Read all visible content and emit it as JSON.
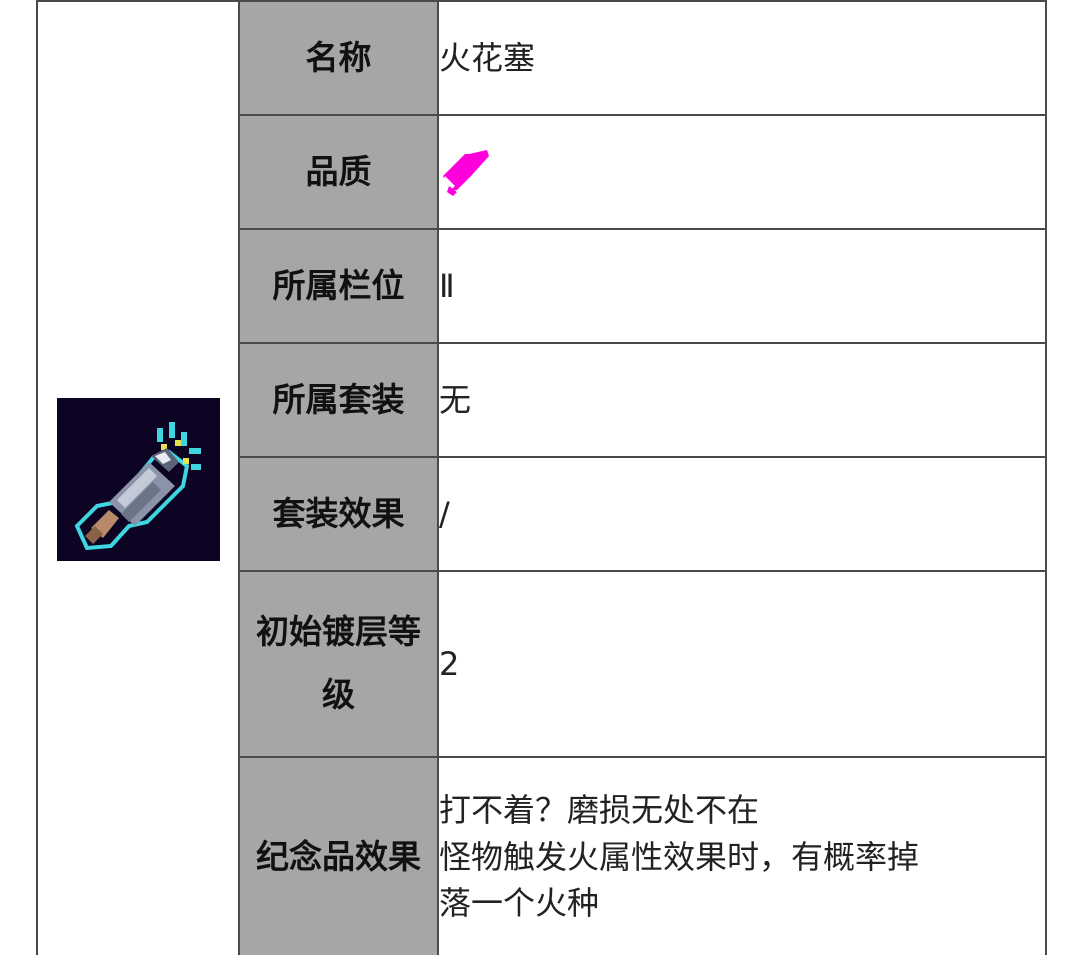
{
  "item": {
    "icon": "spark-plug-item-icon",
    "quality_icon": "magenta-quality-gem-icon",
    "quality_color": "#ff00dd",
    "icon_bg": "#0d0322",
    "glow_color": "#3ed6e0"
  },
  "rows": [
    {
      "label": "名称",
      "value": "火花塞"
    },
    {
      "label": "品质",
      "value": ""
    },
    {
      "label": "所属栏位",
      "value": "Ⅱ"
    },
    {
      "label": "所属套装",
      "value": "无"
    },
    {
      "label": "套装效果",
      "value": "/"
    },
    {
      "label": "初始镀层等级",
      "value": "2"
    },
    {
      "label": "纪念品效果",
      "value_lines": [
        "打不着？磨损无处不在",
        "怪物触发火属性效果时，有概率掉",
        "落一个火种"
      ]
    }
  ]
}
